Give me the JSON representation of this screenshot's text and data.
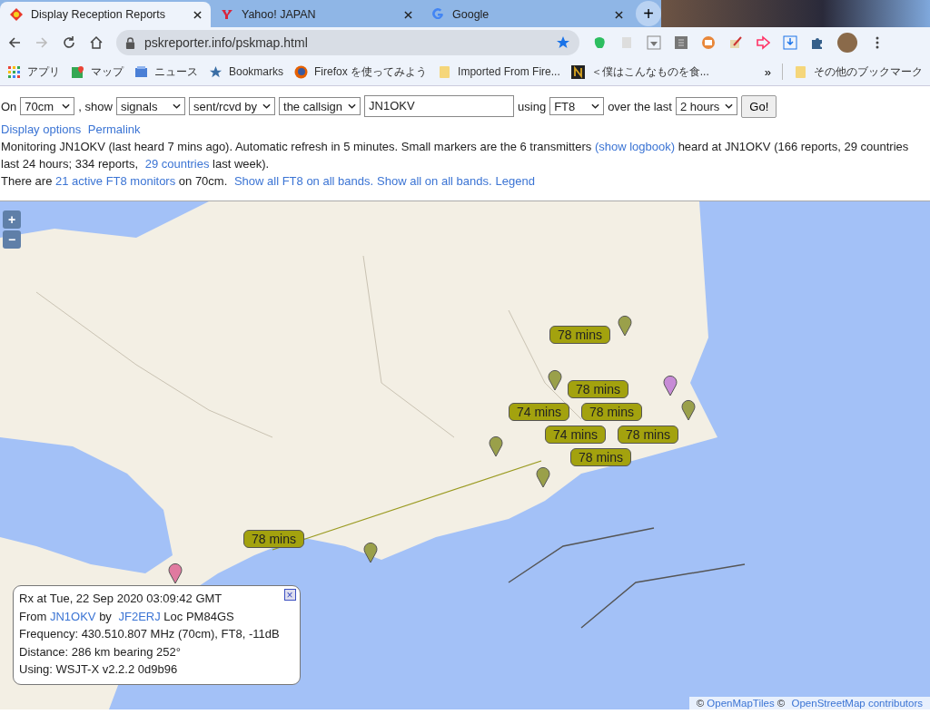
{
  "browser": {
    "tabs": [
      {
        "title": "Display Reception Reports",
        "selected": true,
        "kind": "psk"
      },
      {
        "title": "Yahoo! JAPAN",
        "selected": false,
        "kind": "yahoo"
      },
      {
        "title": "Google",
        "selected": false,
        "kind": "google"
      }
    ],
    "new_tab": "+",
    "address": "pskreporter.info/pskmap.html",
    "bookmarks": [
      {
        "label": "アプリ",
        "kind": "apps"
      },
      {
        "label": "マップ",
        "kind": "maps"
      },
      {
        "label": "ニュース",
        "kind": "news"
      },
      {
        "label": "Bookmarks",
        "kind": "star"
      },
      {
        "label": "Firefox を使ってみよう",
        "kind": "firefox"
      },
      {
        "label": "Imported From Fire...",
        "kind": "folder"
      },
      {
        "label": "＜僕はこんなものを食...",
        "kind": "site"
      }
    ],
    "overflow": "»",
    "other_bookmarks": "その他のブックマーク"
  },
  "form": [
    {
      "kind": "text",
      "text": "On"
    },
    {
      "kind": "select",
      "value": "70cm"
    },
    {
      "kind": "text",
      "text": ", show"
    },
    {
      "kind": "select",
      "value": "signals"
    },
    {
      "kind": "select",
      "value": "sent/rcvd by"
    },
    {
      "kind": "select",
      "value": "the callsign"
    },
    {
      "kind": "input",
      "value": "JN1OKV"
    },
    {
      "kind": "text",
      "text": "using"
    },
    {
      "kind": "select",
      "value": "FT8"
    },
    {
      "kind": "text",
      "text": "over the last"
    },
    {
      "kind": "select",
      "value": "2 hours"
    },
    {
      "kind": "button",
      "text": "Go!"
    }
  ],
  "option_links": [
    "Display options",
    "Permalink"
  ],
  "info": [
    [
      {
        "kind": "text",
        "text": "Monitoring JN1OKV (last heard 7 mins ago). Automatic refresh in 5 minutes. Small markers are the 6 transmitters "
      },
      {
        "kind": "link",
        "text": "(show logbook)"
      },
      {
        "kind": "text",
        "text": " heard at JN1OKV (166 reports, 29 countries last 24 hours; 334 reports, "
      },
      {
        "kind": "link",
        "text": "29 countries"
      },
      {
        "kind": "text",
        "text": " last week)."
      }
    ],
    [
      {
        "kind": "text",
        "text": "There are "
      },
      {
        "kind": "link",
        "text": "21 active FT8 monitors"
      },
      {
        "kind": "text",
        "text": " on 70cm. "
      },
      {
        "kind": "link",
        "text": "Show all FT8 on all bands."
      },
      {
        "kind": "link",
        "text": "Show all on all bands."
      },
      {
        "kind": "link",
        "text": "Legend"
      }
    ]
  ],
  "map": {
    "zoom": [
      "+",
      "−"
    ],
    "markers": [
      "78 mins",
      "78 mins",
      "74 mins",
      "78 mins",
      "74 mins",
      "78 mins",
      "78 mins",
      "78 mins"
    ],
    "popup": {
      "close": "×",
      "lines": [
        [
          {
            "kind": "text",
            "text": "Rx at Tue, 22 Sep 2020 03:09:42 GMT"
          }
        ],
        [
          {
            "kind": "text",
            "text": "From "
          },
          {
            "kind": "link",
            "text": "JN1OKV"
          },
          {
            "kind": "text",
            "text": " by "
          },
          {
            "kind": "link",
            "text": "JF2ERJ"
          },
          {
            "kind": "text",
            "text": " Loc PM84GS"
          }
        ],
        [
          {
            "kind": "text",
            "text": "Frequency: 430.510.807 MHz (70cm), FT8, -11dB"
          }
        ],
        [
          {
            "kind": "text",
            "text": "Distance: 286 km bearing 252°"
          }
        ],
        [
          {
            "kind": "text",
            "text": "Using: WSJT-X v2.2.2 0d9b96"
          }
        ]
      ]
    },
    "attribution": [
      {
        "kind": "text",
        "text": "© "
      },
      {
        "kind": "link",
        "text": "OpenMapTiles"
      },
      {
        "kind": "text",
        "text": " © "
      },
      {
        "kind": "link",
        "text": "OpenStreetMap contributors"
      }
    ]
  }
}
